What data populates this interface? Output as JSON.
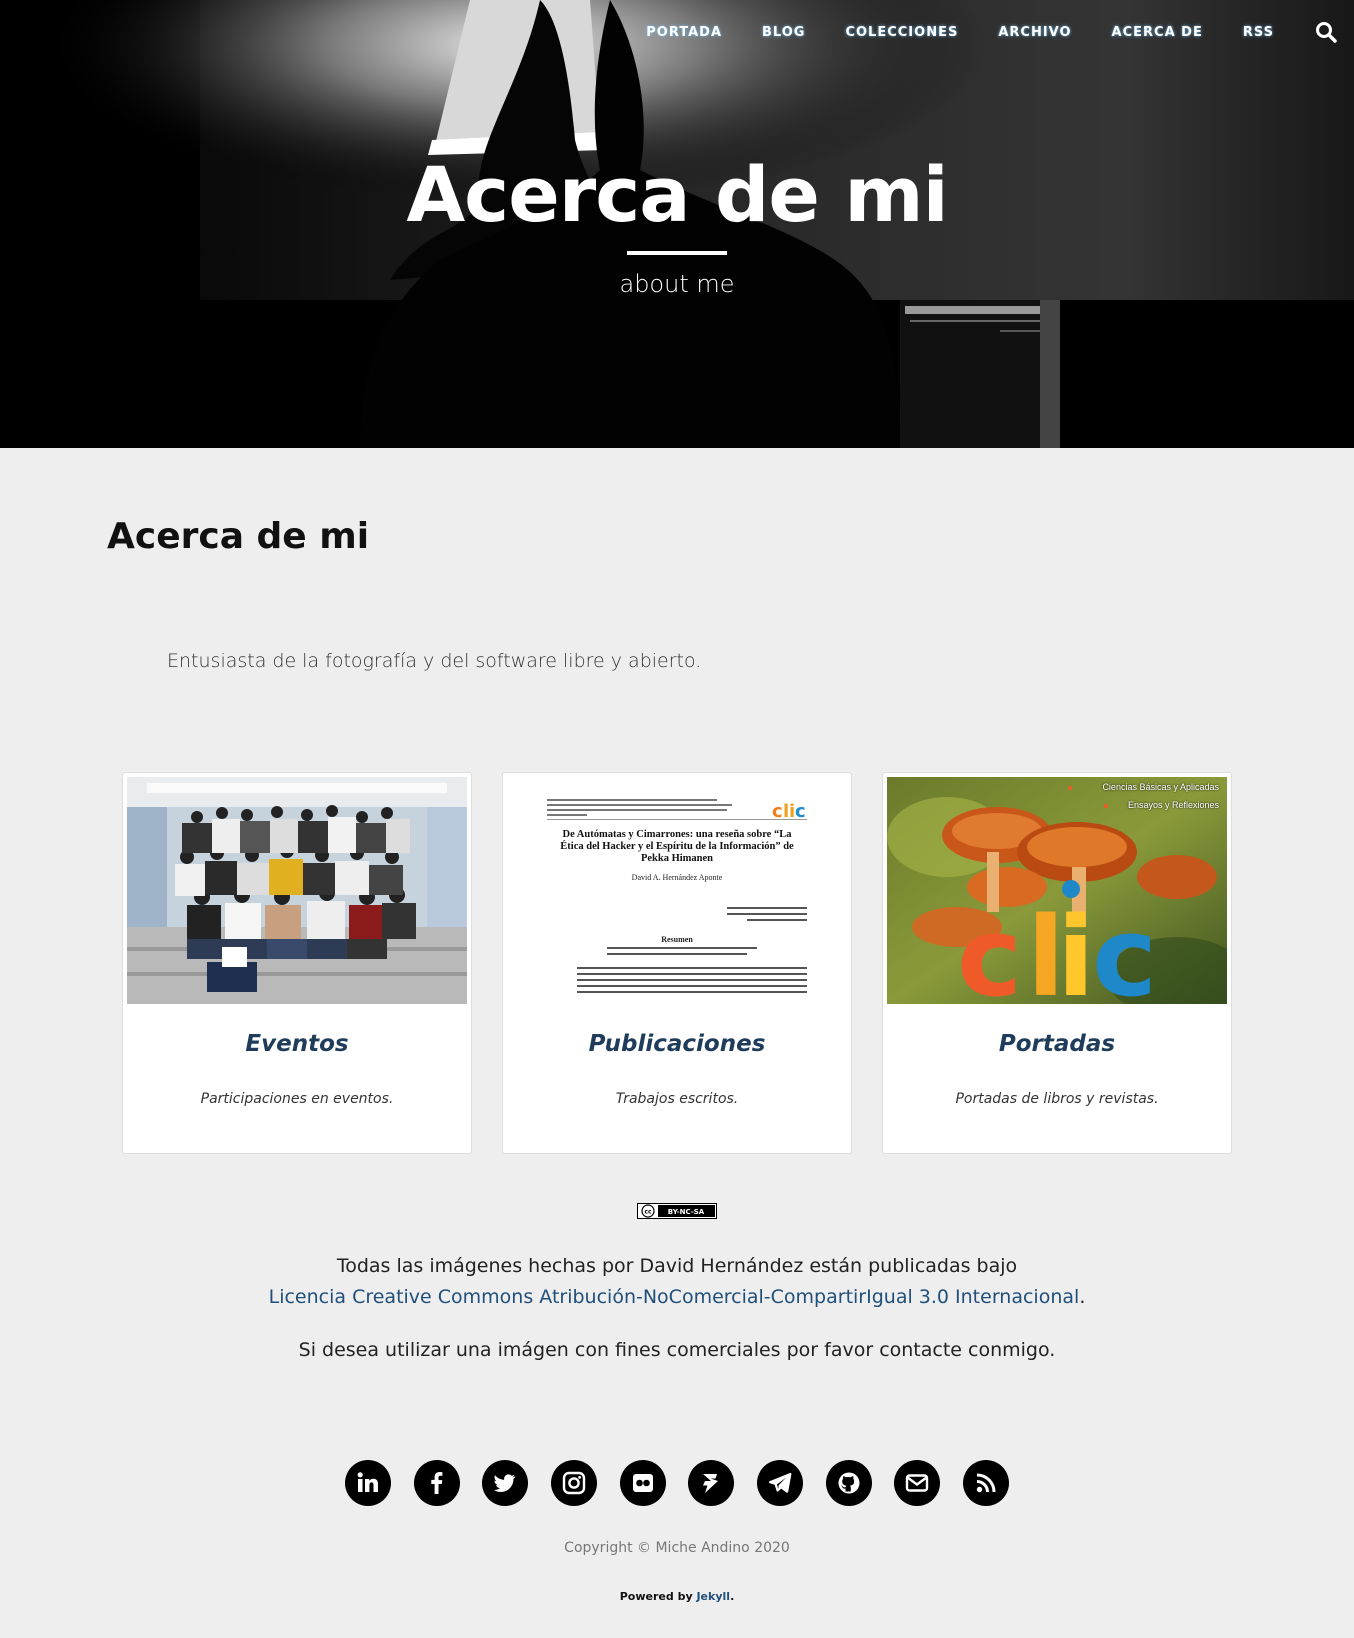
{
  "nav": {
    "items": [
      "PORTADA",
      "BLOG",
      "COLECCIONES",
      "ARCHIVO",
      "ACERCA DE",
      "RSS"
    ],
    "search_icon": "search-icon"
  },
  "hero": {
    "title": "Acerca de mi",
    "subtitle": "about me"
  },
  "main": {
    "title": "Acerca de mi",
    "intro": "Entusiasta de la fotografía y del software libre y abierto."
  },
  "cards": [
    {
      "title": "Eventos",
      "description": "Participaciones en eventos."
    },
    {
      "title": "Publicaciones",
      "description": "Trabajos escritos."
    },
    {
      "title": "Portadas",
      "description": "Portadas de libros y revistas."
    }
  ],
  "publication_preview": {
    "heading": "De Autómatas y Cimarrones: una reseña sobre “La Ética del Hacker y el Espíritu de la Información” de Pekka Himanen",
    "author": "David A. Hernández Aponte",
    "section": "Resumen"
  },
  "portada_preview": {
    "tags": [
      "Ciencias Básicas y Aplicadas",
      "Ensayos y Reflexiones"
    ],
    "logo_text": "clic"
  },
  "license": {
    "badge": "BY-NC-SA",
    "line1": "Todas las imágenes hechas por David Hernández están publicadas bajo",
    "link": "Licencia Creative Commons Atribución-NoComercial-CompartirIgual 3.0 Internacional",
    "period": ".",
    "contact": "Si desea utilizar una imágen con fines comerciales por favor contacte conmigo."
  },
  "social": [
    "linkedin-icon",
    "facebook-icon",
    "twitter-icon",
    "instagram-icon",
    "flickr-icon",
    "diaspora-icon",
    "telegram-icon",
    "github-icon",
    "email-icon",
    "rss-icon"
  ],
  "footer": {
    "copyright": "Copyright © Miche Andino 2020",
    "powered_prefix": "Powered by ",
    "powered_link": "Jekyll",
    "powered_suffix": "."
  },
  "colors": {
    "accent": "#1f3c5a",
    "link": "#1f4f7a",
    "background": "#eeeeee"
  }
}
